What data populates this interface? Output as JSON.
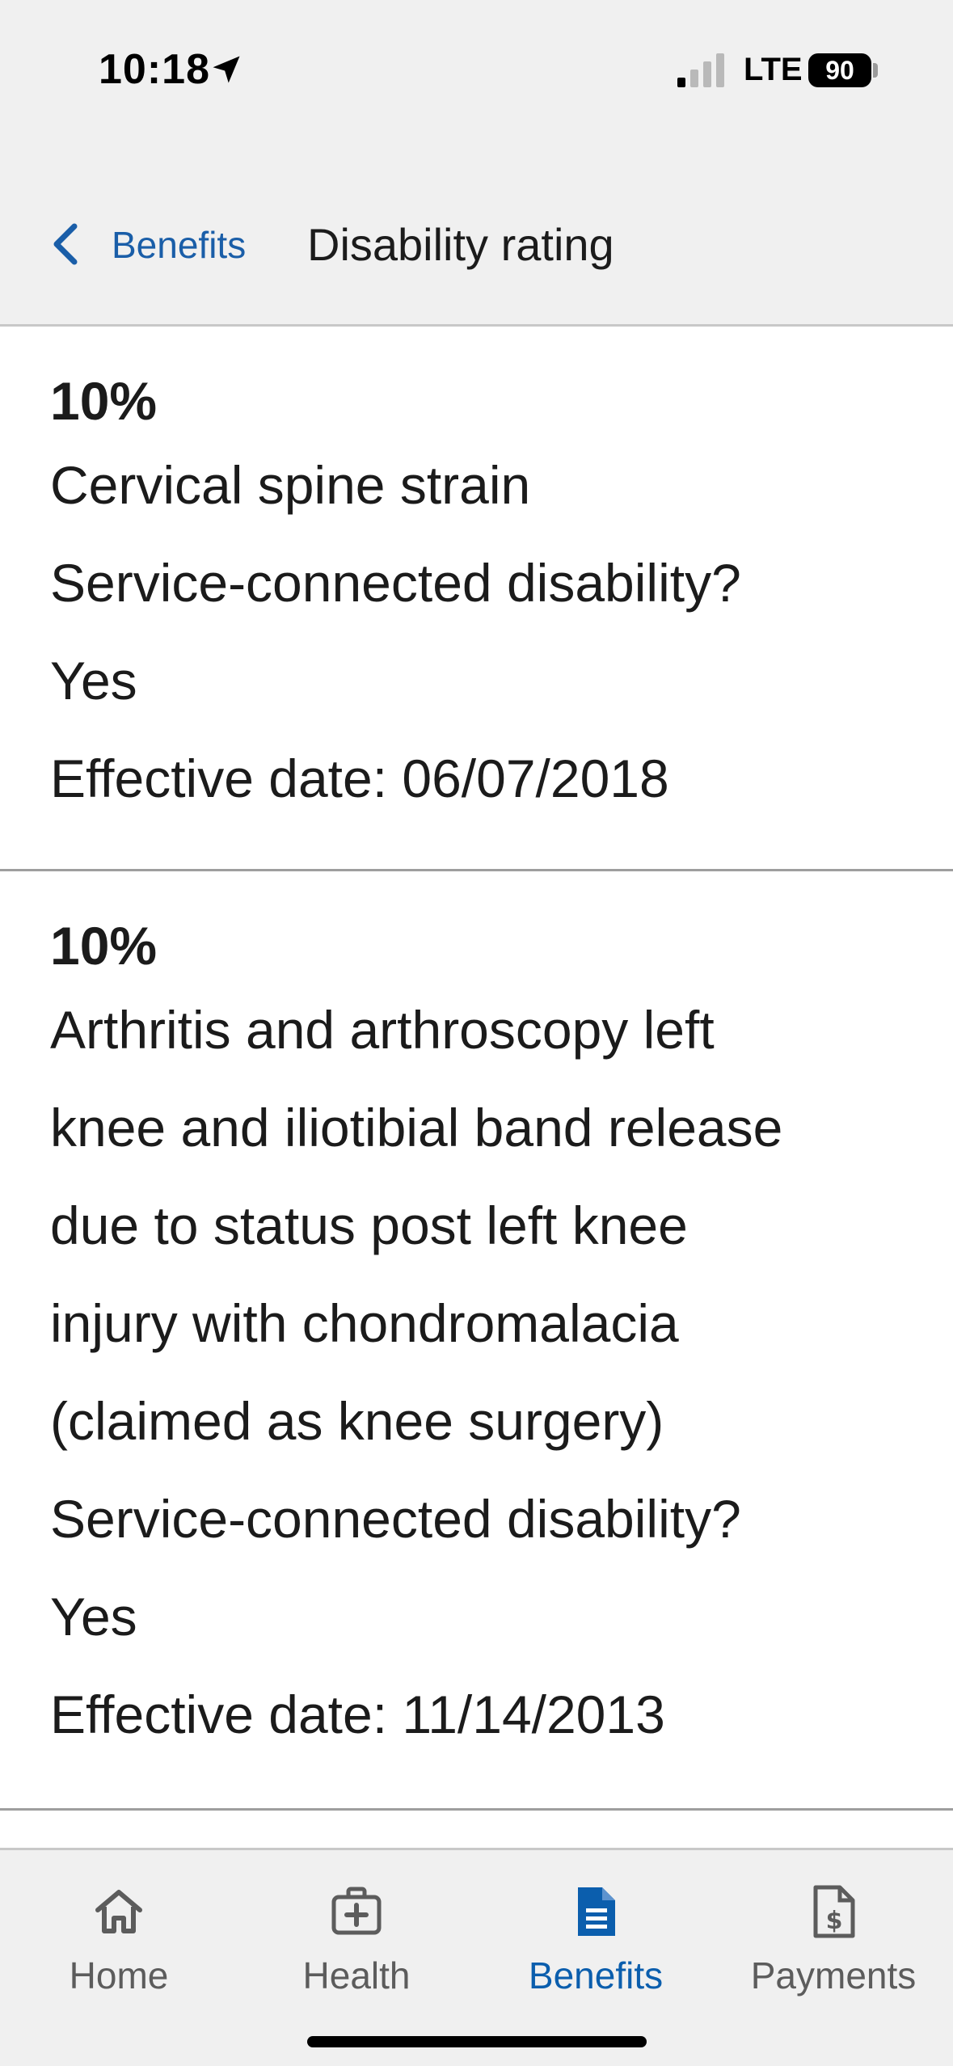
{
  "status_bar": {
    "time": "10:18",
    "network": "LTE",
    "battery": "90"
  },
  "header": {
    "back_label": "Benefits",
    "title": "Disability rating"
  },
  "ratings": [
    {
      "percent": "10%",
      "description_lines": [
        "Cervical spine strain"
      ],
      "service_connected_label": "Service-connected disability?",
      "service_connected_value": "Yes",
      "effective_date": "Effective date:  06/07/2018"
    },
    {
      "percent": "10%",
      "description_lines": [
        "Arthritis and arthroscopy left",
        "knee and iliotibial band release",
        "due to status post left knee",
        "injury with chondromalacia",
        "(claimed as knee surgery)"
      ],
      "service_connected_label": "Service-connected disability?",
      "service_connected_value": "Yes",
      "effective_date": "Effective date:  11/14/2013"
    }
  ],
  "tabs": [
    {
      "label": "Home",
      "icon": "home-icon",
      "active": false
    },
    {
      "label": "Health",
      "icon": "medical-kit-icon",
      "active": false
    },
    {
      "label": "Benefits",
      "icon": "document-icon",
      "active": true
    },
    {
      "label": "Payments",
      "icon": "dollar-document-icon",
      "active": false
    }
  ],
  "colors": {
    "accent": "#0b5ead",
    "link": "#1a5ea8",
    "tab_inactive": "#5c5c5c",
    "header_bg": "#f0f0f0"
  }
}
